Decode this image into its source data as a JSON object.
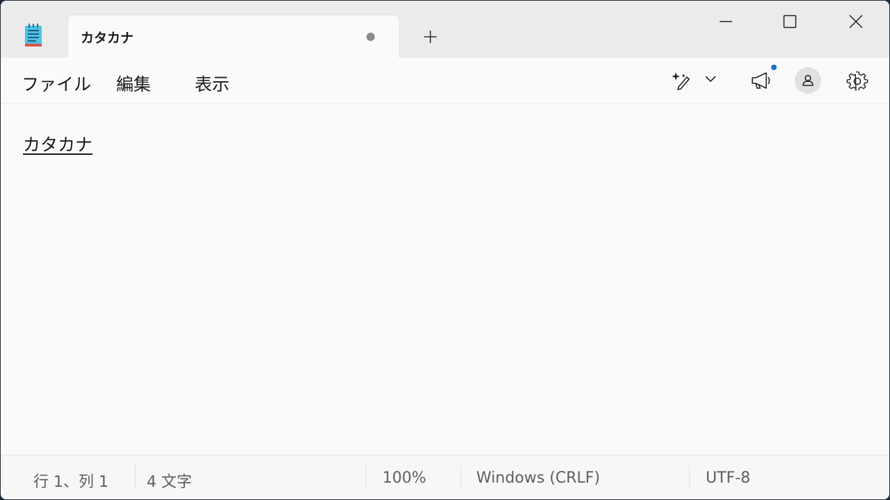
{
  "tab": {
    "title": "カタカナ",
    "unsaved": true
  },
  "menu": {
    "file": "ファイル",
    "edit": "編集",
    "view": "表示"
  },
  "toolbar": {
    "icons": [
      "copilot-pen-icon",
      "chevron-down-icon",
      "megaphone-icon",
      "account-icon",
      "gear-icon"
    ],
    "notification_color": "#1d6fd1"
  },
  "editor": {
    "content": "カタカナ"
  },
  "status": {
    "position": "行 1、列 1",
    "char_count": "4 文字",
    "zoom": "100%",
    "line_ending": "Windows (CRLF)",
    "encoding": "UTF-8"
  }
}
